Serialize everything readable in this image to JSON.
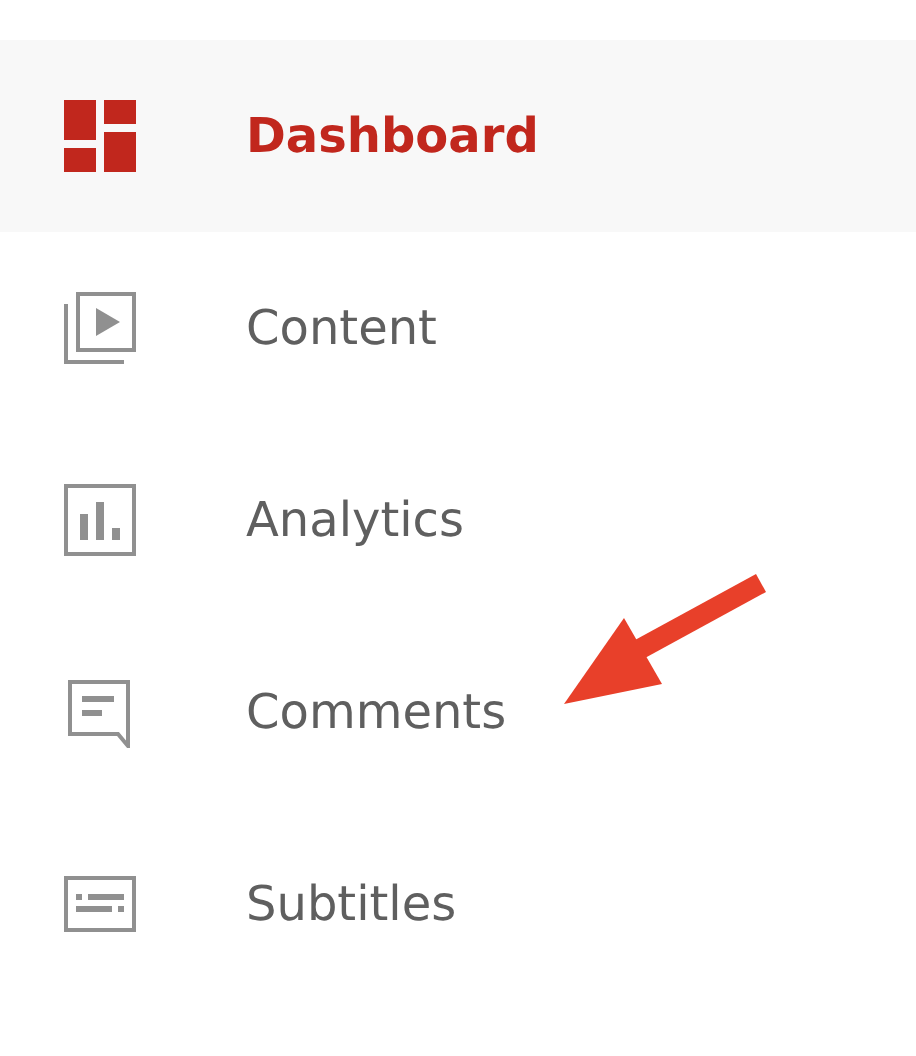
{
  "sidebar": {
    "items": [
      {
        "label": "Dashboard",
        "selected": true
      },
      {
        "label": "Content",
        "selected": false
      },
      {
        "label": "Analytics",
        "selected": false
      },
      {
        "label": "Comments",
        "selected": false
      },
      {
        "label": "Subtitles",
        "selected": false
      }
    ]
  }
}
